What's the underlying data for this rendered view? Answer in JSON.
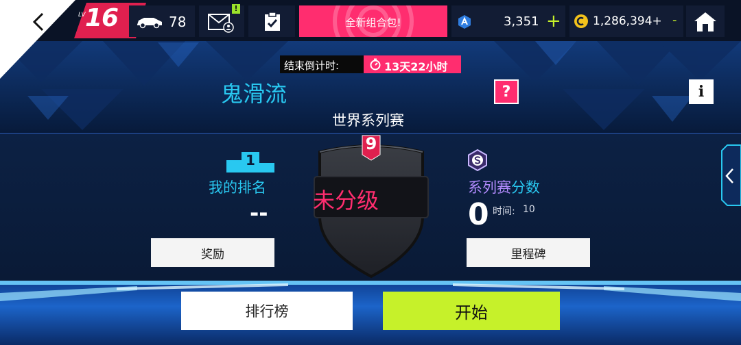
{
  "topbar": {
    "level_prefix": "LV",
    "level": "16",
    "cars_count": "78",
    "mail_badge": "!",
    "promo_label": "全新组合包!",
    "tokens": "3,351",
    "tokens_add": "+",
    "credits": "1,286,394+",
    "credits_extra": "-"
  },
  "event": {
    "countdown_label": "结束倒计时:",
    "countdown_value": "13天22小时",
    "title": "鬼滑流",
    "help": "?",
    "info": "i",
    "series_name": "世界系列赛"
  },
  "rank": {
    "podium_number": "1",
    "label": "我的排名",
    "value": "--",
    "reward_button": "奖励"
  },
  "badge": {
    "number": "9",
    "status": "未分级"
  },
  "score": {
    "label_part1": "系列赛",
    "label_part2": "分数",
    "value": "0",
    "time_label": "时间:",
    "time_value": "10",
    "milestone_button": "里程碑"
  },
  "actions": {
    "leaderboard": "排行榜",
    "start": "开始"
  },
  "colors": {
    "accent_pink": "#ff2d6f",
    "accent_cyan": "#29c8f0",
    "start_green": "#c6f12a",
    "level_bg": "#e0204f"
  }
}
